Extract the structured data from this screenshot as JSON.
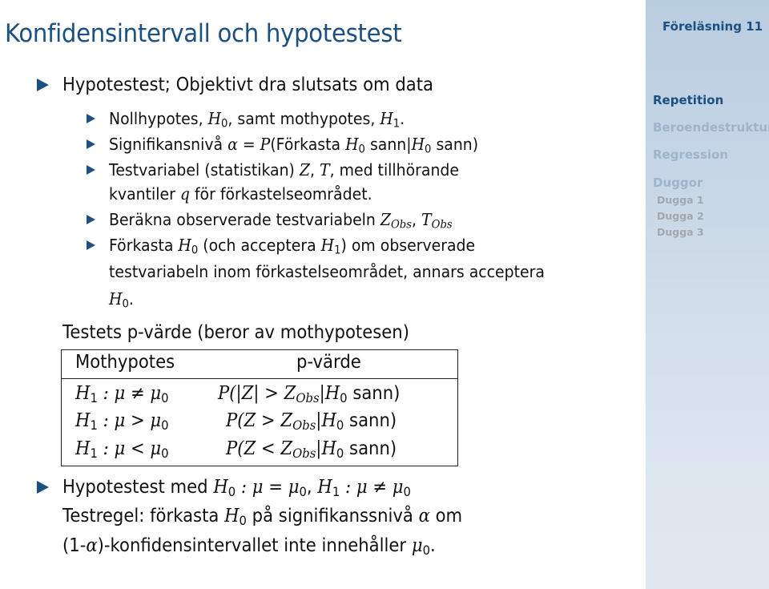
{
  "slide": {
    "title": "Konfidensintervall och hypotestest",
    "bullets": [
      {
        "text": "Hypotestest; Objektivt dra slutsats om data"
      },
      {
        "sub": [
          {
            "pre": "Nollhypotes, ",
            "m1": "H",
            "s1": "0",
            "mid": ", samt mothypotes, ",
            "m2": "H",
            "s2": "1",
            "post": "."
          },
          {
            "pre": "Signifikansnivå ",
            "math": "α = P",
            "rest_a": "(Förkasta ",
            "h": "H",
            "hs": "0",
            "rest_b": " sann|",
            "h2": "H",
            "h2s": "0",
            "rest_c": " sann)"
          },
          {
            "pre": "Testvariabel (statistikan) ",
            "m1": "Z",
            "comma": ", ",
            "m2": "T",
            "post": ", med tillhörande",
            "line2_pre": "kvantiler ",
            "line2_m": "q",
            "line2_post": " för förkastelseområdet."
          },
          {
            "pre": "Beräkna observerade testvariabeln ",
            "m1": "Z",
            "s1": "Obs",
            "comma": ", ",
            "m2": "T",
            "s2": "Obs"
          },
          {
            "pre": "Förkasta ",
            "m1": "H",
            "s1": "0",
            "mid": " (och acceptera ",
            "m2": "H",
            "s2": "1",
            "post": ") om observerade",
            "line2": "testvariabeln inom förkastelseområdet, annars acceptera",
            "line3_m": "H",
            "line3_s": "0",
            "line3_post": "."
          }
        ]
      }
    ],
    "pvalue_intro": "Testets p-värde (beror av mothypotesen)",
    "table": {
      "headers": [
        "Mothypotes",
        "p-värde"
      ],
      "rows": [
        {
          "hyp": "H₁ : μ ≠ μ₀",
          "h": "H",
          "hs": "1",
          "op": " : μ ≠ μ",
          "mus": "0",
          "p_pre": "P(|Z| > Z",
          "p_sub": "Obs",
          "p_mid": "|H",
          "p_hs": "0",
          "p_post": " sann)"
        },
        {
          "hyp": "H₁ : μ > μ₀",
          "h": "H",
          "hs": "1",
          "op": " : μ > μ",
          "mus": "0",
          "p_pre": "P(Z > Z",
          "p_sub": "Obs",
          "p_mid": "|H",
          "p_hs": "0",
          "p_post": " sann)"
        },
        {
          "hyp": "H₁ : μ < μ₀",
          "h": "H",
          "hs": "1",
          "op": " : μ < μ",
          "mus": "0",
          "p_pre": "P(Z < Z",
          "p_sub": "Obs",
          "p_mid": "|H",
          "p_hs": "0",
          "p_post": " sann)"
        }
      ]
    },
    "final": {
      "l1_pre": "Hypotestest med ",
      "l1_h0": "H",
      "l1_h0s": "0",
      "l1_eq": " : μ = μ",
      "l1_mus": "0",
      "l1_comma": ", ",
      "l1_h1": "H",
      "l1_h1s": "1",
      "l1_neq": " : μ ≠ μ",
      "l1_mus2": "0",
      "l2_pre": "Testregel: förkasta ",
      "l2_h": "H",
      "l2_hs": "0",
      "l2_mid": " på signifikanssnivå ",
      "l2_alpha": "α",
      "l2_post": " om",
      "l3_pre": "(1-",
      "l3_alpha": "α",
      "l3_mid": ")-konfidensintervallet inte innehåller ",
      "l3_mu": "μ",
      "l3_mus": "0",
      "l3_post": "."
    }
  },
  "sidebar": {
    "lecture": "Föreläsning 11",
    "sections": [
      {
        "label": "Repetition",
        "active": true
      },
      {
        "label": "Beroendestrukturer",
        "active": false
      },
      {
        "label": "Regression",
        "active": false
      },
      {
        "label": "Duggor",
        "active": false
      }
    ],
    "subsections": [
      "Dugga 1",
      "Dugga 2",
      "Dugga 3"
    ]
  },
  "colors": {
    "accent": "#1c4f82",
    "sidebar_dim": "#9fb4c9",
    "sidebar_sub": "#a2a8ae"
  }
}
